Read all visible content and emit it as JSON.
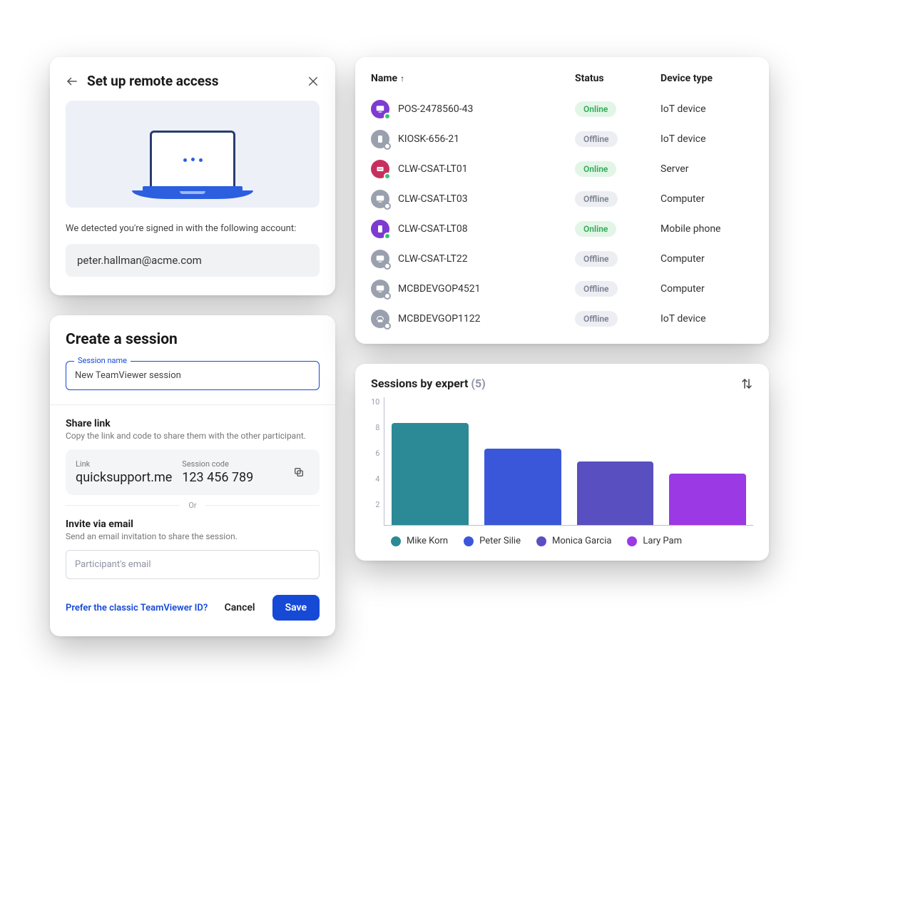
{
  "remote": {
    "title": "Set up remote access",
    "detected_msg": "We detected you're signed in with the following account:",
    "account": "peter.hallman@acme.com"
  },
  "devices": {
    "cols": {
      "name": "Name",
      "status": "Status",
      "type": "Device type"
    },
    "rows": [
      {
        "name": "POS-2478560-43",
        "status": "Online",
        "type": "IoT device",
        "iconColor": "purple",
        "glyph": "monitor"
      },
      {
        "name": "KIOSK-656-21",
        "status": "Offline",
        "type": "IoT device",
        "iconColor": "grey",
        "glyph": "phone"
      },
      {
        "name": "CLW-CSAT-LT01",
        "status": "Online",
        "type": "Server",
        "iconColor": "pink",
        "glyph": "server"
      },
      {
        "name": "CLW-CSAT-LT03",
        "status": "Offline",
        "type": "Computer",
        "iconColor": "grey",
        "glyph": "monitor"
      },
      {
        "name": "CLW-CSAT-LT08",
        "status": "Online",
        "type": "Mobile phone",
        "iconColor": "purple",
        "glyph": "phone"
      },
      {
        "name": "CLW-CSAT-LT22",
        "status": "Offline",
        "type": "Computer",
        "iconColor": "grey",
        "glyph": "monitor"
      },
      {
        "name": "MCBDEVGOP4521",
        "status": "Offline",
        "type": "Computer",
        "iconColor": "grey",
        "glyph": "monitor"
      },
      {
        "name": "MCBDEVGOP1122",
        "status": "Offline",
        "type": "IoT device",
        "iconColor": "grey",
        "glyph": "router"
      }
    ]
  },
  "session": {
    "title": "Create a session",
    "name_label": "Session name",
    "name_value": "New TeamViewer session",
    "share_heading": "Share link",
    "share_sub": "Copy the link and code to share them with the other participant.",
    "link_label": "Link",
    "link_value": "quicksupport.me",
    "code_label": "Session code",
    "code_value": "123 456 789",
    "or": "Or",
    "invite_heading": "Invite via email",
    "invite_sub": "Send an email invitation to share the session.",
    "email_placeholder": "Participant's email",
    "classic_link": "Prefer the classic TeamViewer ID?",
    "cancel": "Cancel",
    "save": "Save"
  },
  "chart": {
    "title": "Sessions by expert",
    "count_display": "(5)"
  },
  "chart_data": {
    "type": "bar",
    "title": "Sessions by expert (5)",
    "categories": [
      "Mike Korn",
      "Peter Silie",
      "Monica Garcia",
      "Lary Pam"
    ],
    "values": [
      8,
      6,
      5,
      4
    ],
    "ylabel": "",
    "xlabel": "",
    "ylim": [
      0,
      10
    ],
    "yticks": [
      2,
      4,
      6,
      8,
      10
    ],
    "colors": [
      "#2b8a95",
      "#3b57d9",
      "#5a4fc0",
      "#9b39e4"
    ]
  }
}
